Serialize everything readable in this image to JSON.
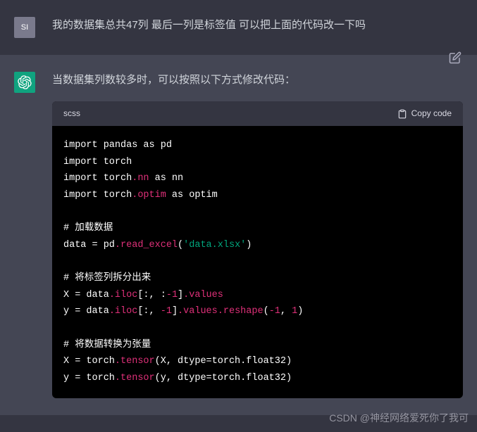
{
  "user": {
    "avatar_label": "SI",
    "message": "我的数据集总共47列  最后一列是标签值 可以把上面的代码改一下吗"
  },
  "assistant": {
    "intro": "当数据集列数较多时，可以按照以下方式修改代码：",
    "code": {
      "language": "scss",
      "copy_label": "Copy code",
      "lines": [
        {
          "t": "import pandas as pd"
        },
        {
          "t": "import torch"
        },
        {
          "t": "import torch",
          "pink": ".nn",
          "rest": " as nn"
        },
        {
          "t": "import torch",
          "pink": ".optim",
          "rest": " as optim"
        },
        {
          "t": ""
        },
        {
          "t": "# 加载数据"
        },
        {
          "t": "data = pd",
          "pink": ".read_excel",
          "rest": "(",
          "str": "'data.xlsx'",
          "rest2": ")"
        },
        {
          "t": ""
        },
        {
          "t": "# 将标签列拆分出来"
        },
        {
          "t": "X = data",
          "pink": ".iloc",
          "rest": "[:, :",
          "num": "-1",
          "rest2": "]",
          "pink2": ".values"
        },
        {
          "t": "y = data",
          "pink": ".iloc",
          "rest": "[:, ",
          "num": "-1",
          "rest2": "]",
          "pink2": ".values",
          "pink3": ".reshape",
          "rest3": "(",
          "num2": "-1",
          "rest4": ", ",
          "num3": "1",
          "rest5": ")"
        },
        {
          "t": ""
        },
        {
          "t": "# 将数据转换为张量"
        },
        {
          "t": "X = torch",
          "pink": ".tensor",
          "rest": "(X, dtype=torch.float32)"
        },
        {
          "t": "y = torch",
          "pink": ".tensor",
          "rest": "(y, dtype=torch.float32)"
        }
      ]
    }
  },
  "watermark": "CSDN @神经网络爱死你了我可"
}
